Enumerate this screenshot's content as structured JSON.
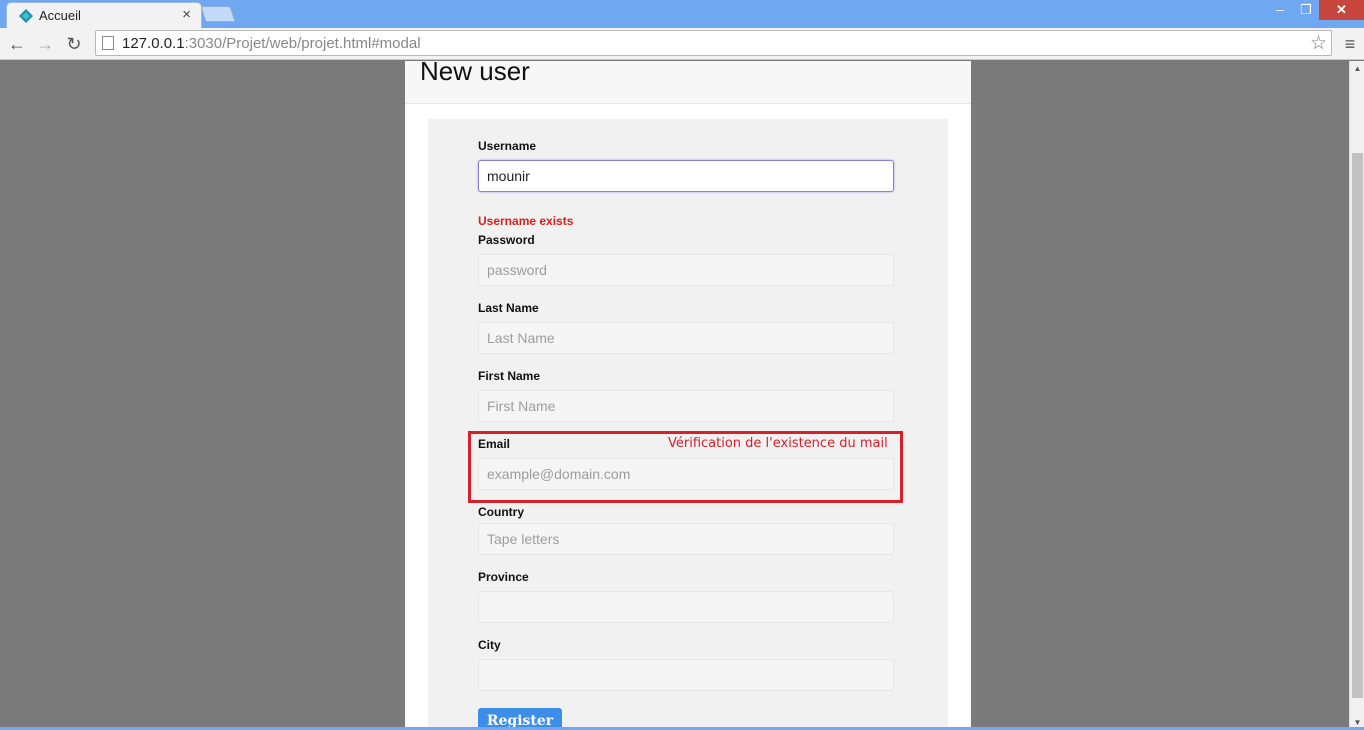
{
  "browser": {
    "tab_title": "Accueil",
    "tab_close": "×",
    "url_host": "127.0.0.1",
    "url_rest": ":3030/Projet/web/projet.html#modal",
    "window_minimize": "‒",
    "window_maximize": "❐",
    "window_close": "✕",
    "nav_back": "←",
    "nav_forward": "→",
    "nav_reload": "↻",
    "bookmark_star": "☆",
    "menu": "≡"
  },
  "modal": {
    "title": "New user"
  },
  "form": {
    "username": {
      "label": "Username",
      "value": "mounir",
      "error": "Username exists"
    },
    "password": {
      "label": "Password",
      "placeholder": "password",
      "value": ""
    },
    "last_name": {
      "label": "Last Name",
      "placeholder": "Last Name",
      "value": ""
    },
    "first_name": {
      "label": "First Name",
      "placeholder": "First Name",
      "value": ""
    },
    "email": {
      "label": "Email",
      "placeholder": "example@domain.com",
      "value": ""
    },
    "country": {
      "label": "Country",
      "placeholder": "Tape letters",
      "value": ""
    },
    "province": {
      "label": "Province",
      "placeholder": "",
      "value": ""
    },
    "city": {
      "label": "City",
      "placeholder": "",
      "value": ""
    },
    "register_label": "Register"
  },
  "annotation": {
    "text": "Vérification de l'existence du mail",
    "color": "#d6202a"
  },
  "colors": {
    "error": "#d3231f",
    "button": "#3d8ee8",
    "titlebar": "#6fa8f0",
    "overlay": "#7a7a7a"
  }
}
